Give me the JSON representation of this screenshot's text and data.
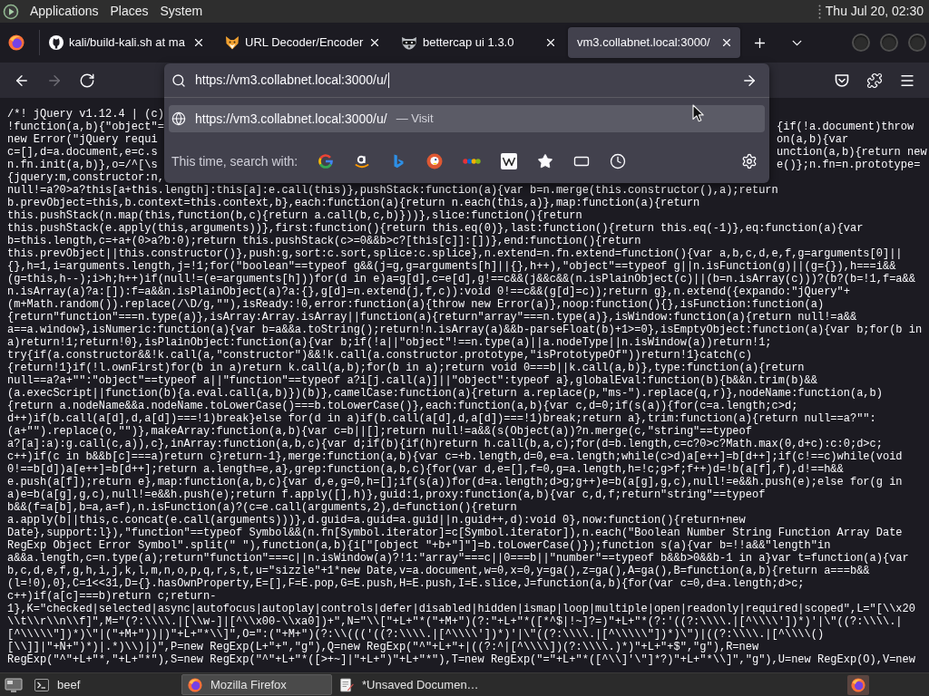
{
  "top_panel": {
    "menus": [
      "Applications",
      "Places",
      "System"
    ],
    "clock": "Thu Jul 20, 02:30"
  },
  "tabs": [
    {
      "title": "kali/build-kali.sh at ma",
      "selected": false
    },
    {
      "title": "URL Decoder/Encoder",
      "selected": false
    },
    {
      "title": "bettercap ui 1.3.0",
      "selected": false
    },
    {
      "title": "vm3.collabnet.local:3000/",
      "selected": true
    }
  ],
  "nav_buttons": [
    {
      "disabled": false
    },
    {
      "disabled": true
    },
    {
      "disabled": false
    }
  ],
  "url_popup": {
    "value": "https://vm3.collabnet.local:3000/u/",
    "suggestions": [
      {
        "url": "https://vm3.collabnet.local:3000/u/",
        "action": "— Visit",
        "selected": true
      }
    ],
    "search_with_label": "This time, search with:"
  },
  "code_lines_under_popup": [
    {
      "left": "/*! jQuery v1.12.4 | (c)"
    },
    {
      "left": "!function(a,b){\"object\"=",
      "right": "{if(!a.document)throw"
    },
    {
      "left": "new Error(\"jQuery requi",
      "right": "on(a,b){var"
    },
    {
      "left": "c=[],d=a.document,e=c.s",
      "right": "unction(a,b){return new"
    },
    {
      "left": "n.fn.init(a,b)},o=/^[\\s",
      "right": "e()};n.fn=n.prototype="
    },
    {
      "left": "{jquery:m,constructor:n,"
    }
  ],
  "code_lines": [
    "null!=a?0>a?this[a+this.length]:this[a]:e.call(this)},pushStack:function(a){var b=n.merge(this.constructor(),a);return",
    "b.prevObject=this,b.context=this.context,b},each:function(a){return n.each(this,a)},map:function(a){return",
    "this.pushStack(n.map(this,function(b,c){return a.call(b,c,b)}))},slice:function(){return",
    "this.pushStack(e.apply(this,arguments))},first:function(){return this.eq(0)},last:function(){return this.eq(-1)},eq:function(a){var",
    "b=this.length,c=+a+(0>a?b:0);return this.pushStack(c>=0&&b>c?[this[c]]:[])},end:function(){return",
    "this.prevObject||this.constructor()},push:g,sort:c.sort,splice:c.splice},n.extend=n.fn.extend=function(){var a,b,c,d,e,f,g=arguments[0]||",
    "{},h=1,i=arguments.length,j=!1;for(\"boolean\"==typeof g&&(j=g,g=arguments[h]||{},h++),\"object\"==typeof g||n.isFunction(g)||(g={}),h===i&&",
    "(g=this,h--);i>h;h++)if(null!=(e=arguments[h]))for(d in e)a=g[d],c=e[d],g!==c&&(j&&c&&(n.isPlainObject(c)||(b=n.isArray(c)))?(b?(b=!1,f=a&&",
    "n.isArray(a)?a:[]):f=a&&n.isPlainObject(a)?a:{},g[d]=n.extend(j,f,c)):void 0!==c&&(g[d]=c));return g},n.extend({expando:\"jQuery\"+",
    "(m+Math.random()).replace(/\\D/g,\"\"),isReady:!0,error:function(a){throw new Error(a)},noop:function(){},isFunction:function(a)",
    "{return\"function\"===n.type(a)},isArray:Array.isArray||function(a){return\"array\"===n.type(a)},isWindow:function(a){return null!=a&&",
    "a==a.window},isNumeric:function(a){var b=a&&a.toString();return!n.isArray(a)&&b-parseFloat(b)+1>=0},isEmptyObject:function(a){var b;for(b in",
    "a)return!1;return!0},isPlainObject:function(a){var b;if(!a||\"object\"!==n.type(a)||a.nodeType||n.isWindow(a))return!1;",
    "try{if(a.constructor&&!k.call(a,\"constructor\")&&!k.call(a.constructor.prototype,\"isPrototypeOf\"))return!1}catch(c)",
    "{return!1}if(!l.ownFirst)for(b in a)return k.call(a,b);for(b in a);return void 0===b||k.call(a,b)},type:function(a){return",
    "null==a?a+\"\":\"object\"==typeof a||\"function\"==typeof a?i[j.call(a)]||\"object\":typeof a},globalEval:function(b){b&&n.trim(b)&&",
    "(a.execScript||function(b){a.eval.call(a,b)})(b)},camelCase:function(a){return a.replace(p,\"ms-\").replace(q,r)},nodeName:function(a,b)",
    "{return a.nodeName&&a.nodeName.toLowerCase()===b.toLowerCase()},each:function(a,b){var c,d=0;if(s(a)){for(c=a.length;c>d;",
    "d++)if(b.call(a[d],d,a[d])===!1)break}else for(d in a)if(b.call(a[d],d,a[d])===!1)break;return a},trim:function(a){return null==a?\"\":",
    "(a+\"\").replace(o,\"\")},makeArray:function(a,b){var c=b||[];return null!=a&&(s(Object(a))?n.merge(c,\"string\"==typeof",
    "a?[a]:a):g.call(c,a)),c},inArray:function(a,b,c){var d;if(b){if(h)return h.call(b,a,c);for(d=b.length,c=c?0>c?Math.max(0,d+c):c:0;d>c;",
    "c++)if(c in b&&b[c]===a)return c}return-1},merge:function(a,b){var c=+b.length,d=0,e=a.length;while(c>d)a[e++]=b[d++];if(c!==c)while(void",
    "0!==b[d])a[e++]=b[d++];return a.length=e,a},grep:function(a,b,c){for(var d,e=[],f=0,g=a.length,h=!c;g>f;f++)d=!b(a[f],f),d!==h&&",
    "e.push(a[f]);return e},map:function(a,b,c){var d,e,g=0,h=[];if(s(a))for(d=a.length;d>g;g++)e=b(a[g],g,c),null!=e&&h.push(e);else for(g in",
    "a)e=b(a[g],g,c),null!=e&&h.push(e);return f.apply([],h)},guid:1,proxy:function(a,b){var c,d,f;return\"string\"==typeof",
    "b&&(f=a[b],b=a,a=f),n.isFunction(a)?(c=e.call(arguments,2),d=function(){return",
    "a.apply(b||this,c.concat(e.call(arguments)))},d.guid=a.guid=a.guid||n.guid++,d):void 0},now:function(){return+new",
    "Date},support:l}),\"function\"==typeof Symbol&&(n.fn[Symbol.iterator]=c[Symbol.iterator]),n.each(\"Boolean Number String Function Array Date",
    "RegExp Object Error Symbol\".split(\" \"),function(a,b){i[\"[object \"+b+\"]\"]=b.toLowerCase()});function s(a){var b=!!a&&\"length\"in",
    "a&&a.length,c=n.type(a);return\"function\"===c||n.isWindow(a)?!1:\"array\"===c||0===b||\"number\"==typeof b&&b>0&&b-1 in a}var t=function(a){var",
    "b,c,d,e,f,g,h,i,j,k,l,m,n,o,p,q,r,s,t,u=\"sizzle\"+1*new Date,v=a.document,w=0,x=0,y=ga(),z=ga(),A=ga(),B=function(a,b){return a===b&&",
    "(l=!0),0},C=1<<31,D={}.hasOwnProperty,E=[],F=E.pop,G=E.push,H=E.push,I=E.slice,J=function(a,b){for(var c=0,d=a.length;d>c;",
    "c++)if(a[c]===b)return c;return-",
    "1},K=\"checked|selected|async|autofocus|autoplay|controls|defer|disabled|hidden|ismap|loop|multiple|open|readonly|required|scoped\",L=\"[\\\\x20",
    "\\\\t\\\\r\\\\n\\\\f]\",M=\"(?:\\\\\\\\.|[\\\\w-]|[^\\\\x00-\\\\xa0])+\",N=\"\\\\[\"+L+\"*(\"+M+\")(?:\"+L+\"*([*^$|!~]?=)\"+L+\"*(?:'((?:\\\\\\\\.|[^\\\\\\\\'])*)'|\\\"((?:\\\\\\\\.|",
    "[^\\\\\\\\\\\"])*)\\\"|(\"+M+\"))|)\"+L+\"*\\\\]\",O=\":(\"+M+\")(?:\\\\((('((?:\\\\\\\\.|[^\\\\\\\\'])*)'|\\\"((?:\\\\\\\\.|[^\\\\\\\\\\\"])*)\\\")|((?:\\\\\\\\.|[^\\\\\\\\()",
    "[\\\\]]|\"+N+\")*)|.*)\\\\)|)\",P=new RegExp(L+\"+\",\"g\"),Q=new RegExp(\"^\"+L+\"+|((?:^|[^\\\\\\\\])(?:\\\\\\\\.)*)\"+L+\"+$\",\"g\"),R=new",
    "RegExp(\"^\"+L+\"*,\"+L+\"*\"),S=new RegExp(\"^\"+L+\"*([>+~]|\"+L+\")\"+L+\"*\"),T=new RegExp(\"=\"+L+\"*([^\\\\]'\\\"]*?)\"+L+\"*\\\\]\",\"g\"),U=new RegExp(O),V=new"
  ],
  "taskbar": {
    "items": [
      {
        "title": "beef",
        "selected": false
      },
      {
        "title": "Mozilla Firefox",
        "selected": true
      },
      {
        "title": "*Unsaved Documen…",
        "selected": false
      }
    ]
  }
}
